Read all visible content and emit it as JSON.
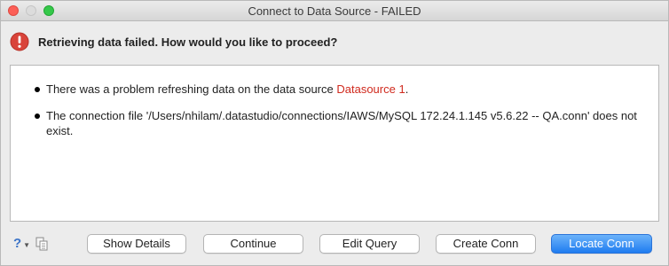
{
  "window": {
    "title": "Connect to Data Source - FAILED"
  },
  "header": {
    "icon": "error-icon",
    "text": "Retrieving data failed. How would you like to proceed?"
  },
  "messages": {
    "line1_text": "There was a problem refreshing data on the data source ",
    "line1_link": "Datasource 1",
    "line1_end": ".",
    "line2": "The connection file '/Users/nhilam/.datastudio/connections/IAWS/MySQL 172.24.1.145 v5.6.22 -- QA.conn' does not exist."
  },
  "footer": {
    "help_icon": "help-icon",
    "help_glyph": "?",
    "copy_icon": "copy-icon",
    "buttons": {
      "show_details": "Show Details",
      "continue": "Continue",
      "edit_query": "Edit Query",
      "create_conn": "Create Conn",
      "locate_conn": "Locate Conn"
    }
  },
  "colors": {
    "accent": "#1f7cf0",
    "error_red": "#d9443a",
    "link_red": "#d02a1e"
  }
}
